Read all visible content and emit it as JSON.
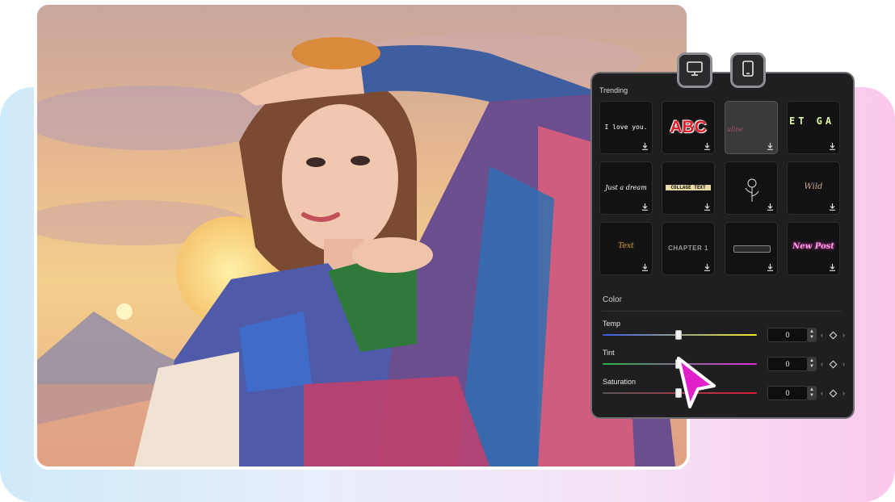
{
  "panel": {
    "section_title": "Trending",
    "tiles": [
      {
        "name": "tile-i-love-you",
        "text": "I love you."
      },
      {
        "name": "tile-abc",
        "text": "ABC"
      },
      {
        "name": "tile-script-pink",
        "text": "uline"
      },
      {
        "name": "tile-set-gam",
        "text": "ET GA"
      },
      {
        "name": "tile-just-a-dream",
        "text": "Just a dream"
      },
      {
        "name": "tile-collage",
        "text": "COLLAGE TEXT"
      },
      {
        "name": "tile-rose",
        "text": ""
      },
      {
        "name": "tile-wild",
        "text": "Wild"
      },
      {
        "name": "tile-glitter",
        "text": "Text"
      },
      {
        "name": "tile-chapter-1",
        "text": "CHAPTER 1"
      },
      {
        "name": "tile-bar",
        "text": ""
      },
      {
        "name": "tile-new-post",
        "text": "New Post"
      }
    ],
    "color": {
      "title": "Color",
      "temp": {
        "label": "Temp",
        "value": "0"
      },
      "tint": {
        "label": "Tint",
        "value": "0"
      },
      "saturation": {
        "label": "Saturation",
        "value": "0"
      }
    }
  },
  "device_buttons": [
    "monitor-icon",
    "phone-icon"
  ],
  "colors": {
    "cursor": "#e020c9",
    "panel_bg": "#1f1f21",
    "abc_red": "#e01e2a"
  }
}
